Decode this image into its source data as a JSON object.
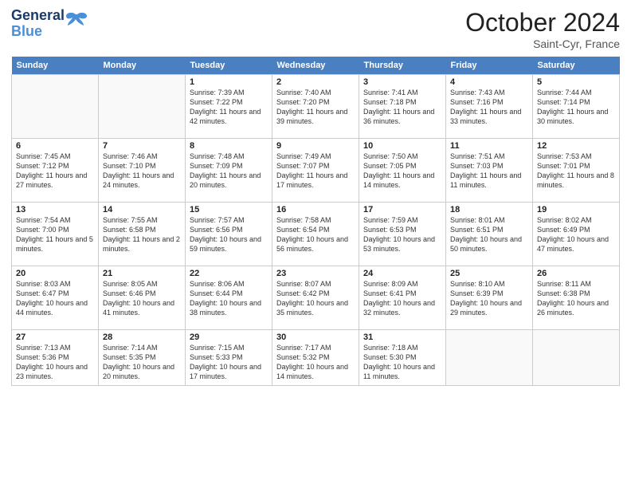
{
  "header": {
    "logo_line1": "General",
    "logo_line2": "Blue",
    "month": "October 2024",
    "location": "Saint-Cyr, France"
  },
  "weekdays": [
    "Sunday",
    "Monday",
    "Tuesday",
    "Wednesday",
    "Thursday",
    "Friday",
    "Saturday"
  ],
  "weeks": [
    [
      {
        "day": "",
        "info": ""
      },
      {
        "day": "",
        "info": ""
      },
      {
        "day": "1",
        "info": "Sunrise: 7:39 AM\nSunset: 7:22 PM\nDaylight: 11 hours and 42 minutes."
      },
      {
        "day": "2",
        "info": "Sunrise: 7:40 AM\nSunset: 7:20 PM\nDaylight: 11 hours and 39 minutes."
      },
      {
        "day": "3",
        "info": "Sunrise: 7:41 AM\nSunset: 7:18 PM\nDaylight: 11 hours and 36 minutes."
      },
      {
        "day": "4",
        "info": "Sunrise: 7:43 AM\nSunset: 7:16 PM\nDaylight: 11 hours and 33 minutes."
      },
      {
        "day": "5",
        "info": "Sunrise: 7:44 AM\nSunset: 7:14 PM\nDaylight: 11 hours and 30 minutes."
      }
    ],
    [
      {
        "day": "6",
        "info": "Sunrise: 7:45 AM\nSunset: 7:12 PM\nDaylight: 11 hours and 27 minutes."
      },
      {
        "day": "7",
        "info": "Sunrise: 7:46 AM\nSunset: 7:10 PM\nDaylight: 11 hours and 24 minutes."
      },
      {
        "day": "8",
        "info": "Sunrise: 7:48 AM\nSunset: 7:09 PM\nDaylight: 11 hours and 20 minutes."
      },
      {
        "day": "9",
        "info": "Sunrise: 7:49 AM\nSunset: 7:07 PM\nDaylight: 11 hours and 17 minutes."
      },
      {
        "day": "10",
        "info": "Sunrise: 7:50 AM\nSunset: 7:05 PM\nDaylight: 11 hours and 14 minutes."
      },
      {
        "day": "11",
        "info": "Sunrise: 7:51 AM\nSunset: 7:03 PM\nDaylight: 11 hours and 11 minutes."
      },
      {
        "day": "12",
        "info": "Sunrise: 7:53 AM\nSunset: 7:01 PM\nDaylight: 11 hours and 8 minutes."
      }
    ],
    [
      {
        "day": "13",
        "info": "Sunrise: 7:54 AM\nSunset: 7:00 PM\nDaylight: 11 hours and 5 minutes."
      },
      {
        "day": "14",
        "info": "Sunrise: 7:55 AM\nSunset: 6:58 PM\nDaylight: 11 hours and 2 minutes."
      },
      {
        "day": "15",
        "info": "Sunrise: 7:57 AM\nSunset: 6:56 PM\nDaylight: 10 hours and 59 minutes."
      },
      {
        "day": "16",
        "info": "Sunrise: 7:58 AM\nSunset: 6:54 PM\nDaylight: 10 hours and 56 minutes."
      },
      {
        "day": "17",
        "info": "Sunrise: 7:59 AM\nSunset: 6:53 PM\nDaylight: 10 hours and 53 minutes."
      },
      {
        "day": "18",
        "info": "Sunrise: 8:01 AM\nSunset: 6:51 PM\nDaylight: 10 hours and 50 minutes."
      },
      {
        "day": "19",
        "info": "Sunrise: 8:02 AM\nSunset: 6:49 PM\nDaylight: 10 hours and 47 minutes."
      }
    ],
    [
      {
        "day": "20",
        "info": "Sunrise: 8:03 AM\nSunset: 6:47 PM\nDaylight: 10 hours and 44 minutes."
      },
      {
        "day": "21",
        "info": "Sunrise: 8:05 AM\nSunset: 6:46 PM\nDaylight: 10 hours and 41 minutes."
      },
      {
        "day": "22",
        "info": "Sunrise: 8:06 AM\nSunset: 6:44 PM\nDaylight: 10 hours and 38 minutes."
      },
      {
        "day": "23",
        "info": "Sunrise: 8:07 AM\nSunset: 6:42 PM\nDaylight: 10 hours and 35 minutes."
      },
      {
        "day": "24",
        "info": "Sunrise: 8:09 AM\nSunset: 6:41 PM\nDaylight: 10 hours and 32 minutes."
      },
      {
        "day": "25",
        "info": "Sunrise: 8:10 AM\nSunset: 6:39 PM\nDaylight: 10 hours and 29 minutes."
      },
      {
        "day": "26",
        "info": "Sunrise: 8:11 AM\nSunset: 6:38 PM\nDaylight: 10 hours and 26 minutes."
      }
    ],
    [
      {
        "day": "27",
        "info": "Sunrise: 7:13 AM\nSunset: 5:36 PM\nDaylight: 10 hours and 23 minutes."
      },
      {
        "day": "28",
        "info": "Sunrise: 7:14 AM\nSunset: 5:35 PM\nDaylight: 10 hours and 20 minutes."
      },
      {
        "day": "29",
        "info": "Sunrise: 7:15 AM\nSunset: 5:33 PM\nDaylight: 10 hours and 17 minutes."
      },
      {
        "day": "30",
        "info": "Sunrise: 7:17 AM\nSunset: 5:32 PM\nDaylight: 10 hours and 14 minutes."
      },
      {
        "day": "31",
        "info": "Sunrise: 7:18 AM\nSunset: 5:30 PM\nDaylight: 10 hours and 11 minutes."
      },
      {
        "day": "",
        "info": ""
      },
      {
        "day": "",
        "info": ""
      }
    ]
  ]
}
